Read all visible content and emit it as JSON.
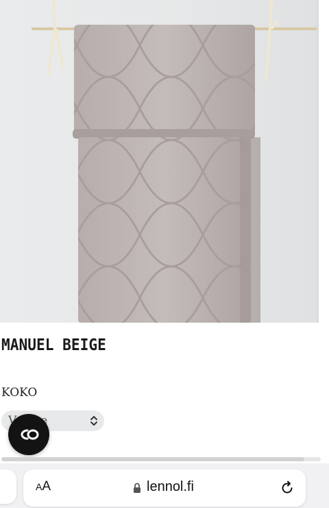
{
  "product": {
    "image_alt": "quilted grey blanket hanging on rail",
    "title": "MANUEL BEIGE",
    "size_label": "KOKO",
    "size_select": {
      "value": "Valitse"
    }
  },
  "chat_button": {
    "icon": "chat-logo-icon"
  },
  "browser": {
    "text_size_small": "A",
    "text_size_big": "A",
    "url": "lennol.fi",
    "lock_icon": "lock-icon",
    "reload_icon": "reload-icon"
  },
  "colors": {
    "blanket": "#bdb4b2",
    "wall": "#e6e8e9",
    "chat_button": "#131313",
    "browser_bar": "#f1f1f3"
  }
}
